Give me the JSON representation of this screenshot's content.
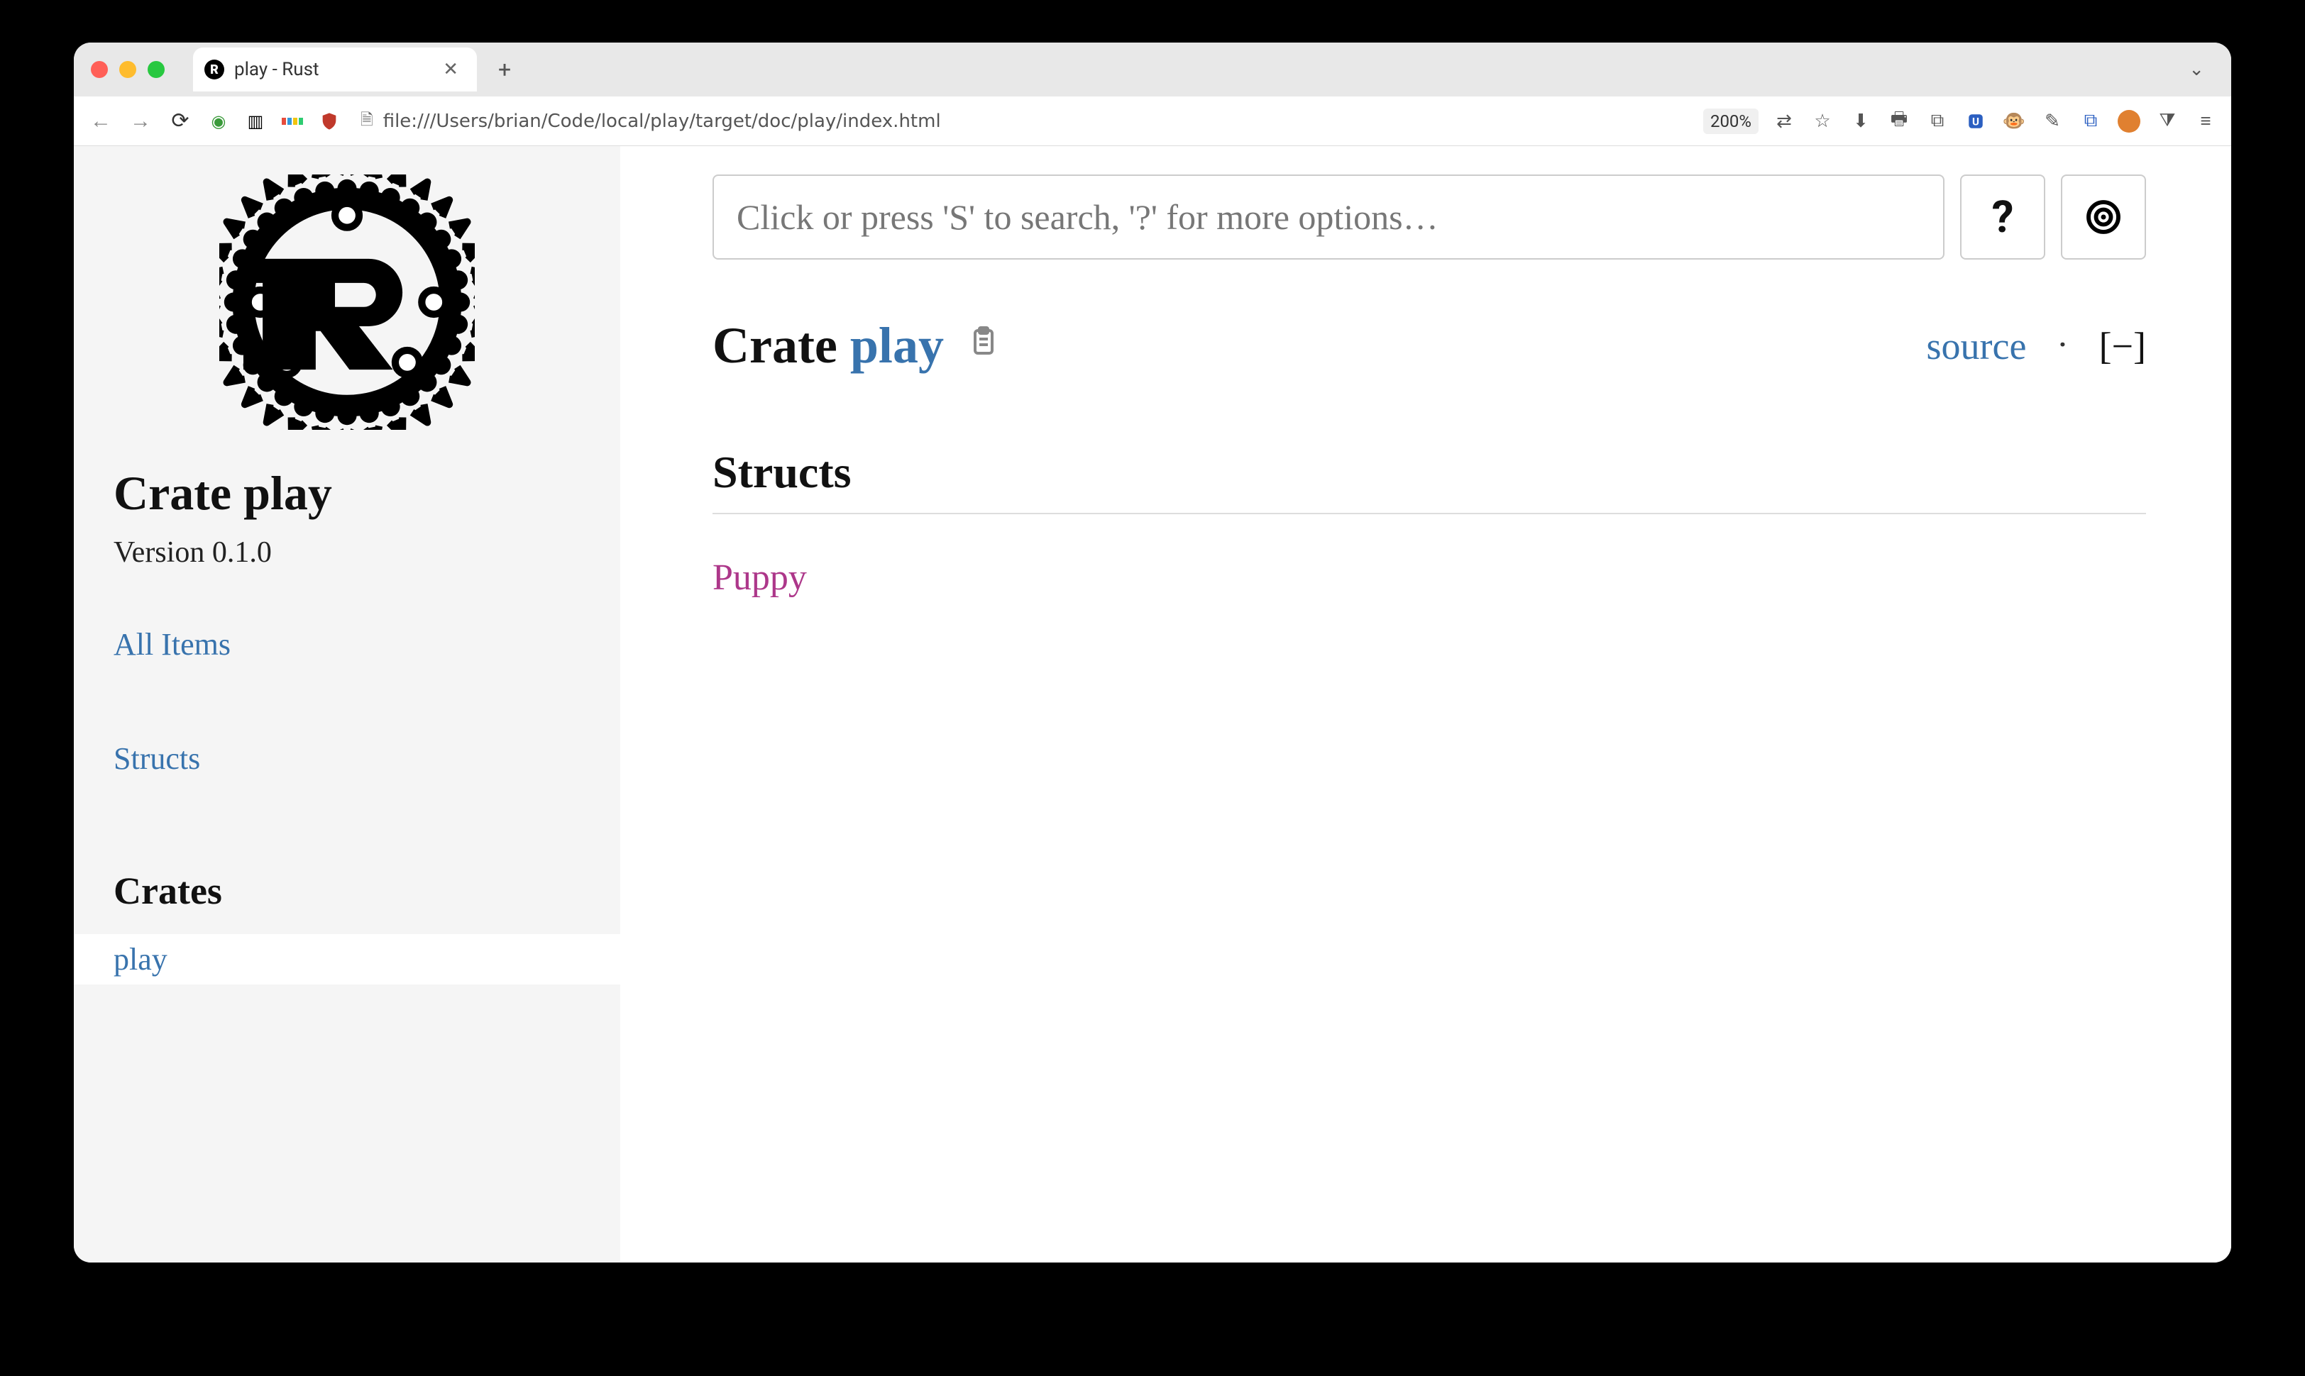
{
  "browser": {
    "tab": {
      "title": "play - Rust"
    },
    "new_tab_label": "+",
    "url": "file:///Users/brian/Code/local/play/target/doc/play/index.html",
    "zoom": "200%"
  },
  "sidebar": {
    "title_prefix": "Crate ",
    "title_name": "play",
    "version": "Version 0.1.0",
    "all_items": "All Items",
    "structs_link": "Structs",
    "crates_heading": "Crates",
    "crates": [
      {
        "name": "play"
      }
    ]
  },
  "main": {
    "search_placeholder": "Click or press 'S' to search, '?' for more options…",
    "help_label": "?",
    "heading_prefix": "Crate ",
    "heading_name": "play",
    "source_label": "source",
    "collapse_label": "[−]",
    "structs_heading": "Structs",
    "structs": [
      {
        "name": "Puppy"
      }
    ]
  }
}
